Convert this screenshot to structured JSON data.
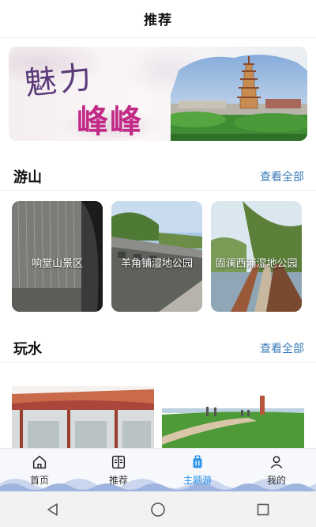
{
  "header": {
    "title": "推荐"
  },
  "banner": {
    "calligraphy_line1": "魅力",
    "calligraphy_line2": "峰峰"
  },
  "sections": {
    "mountain": {
      "label": "游山",
      "more": "查看全部",
      "cards": [
        {
          "label": "响堂山景区"
        },
        {
          "label": "羊角铺湿地公园"
        },
        {
          "label": "固澜西浦湿地公园"
        }
      ]
    },
    "water": {
      "label": "玩水",
      "more": "查看全部"
    }
  },
  "tabbar": {
    "items": [
      {
        "label": "首页",
        "icon": "home-icon"
      },
      {
        "label": "推荐",
        "icon": "book-icon"
      },
      {
        "label": "主题游",
        "icon": "luggage-icon"
      },
      {
        "label": "我的",
        "icon": "person-icon"
      }
    ],
    "active_index": 2
  },
  "system_nav": {
    "buttons": [
      "back-icon",
      "home-circle-icon",
      "recents-square-icon"
    ]
  },
  "colors": {
    "accent": "#2c93e8",
    "link": "#3a7bb8",
    "calligraphy_purple": "#5a3a78",
    "calligraphy_pink": "#c12a86"
  }
}
